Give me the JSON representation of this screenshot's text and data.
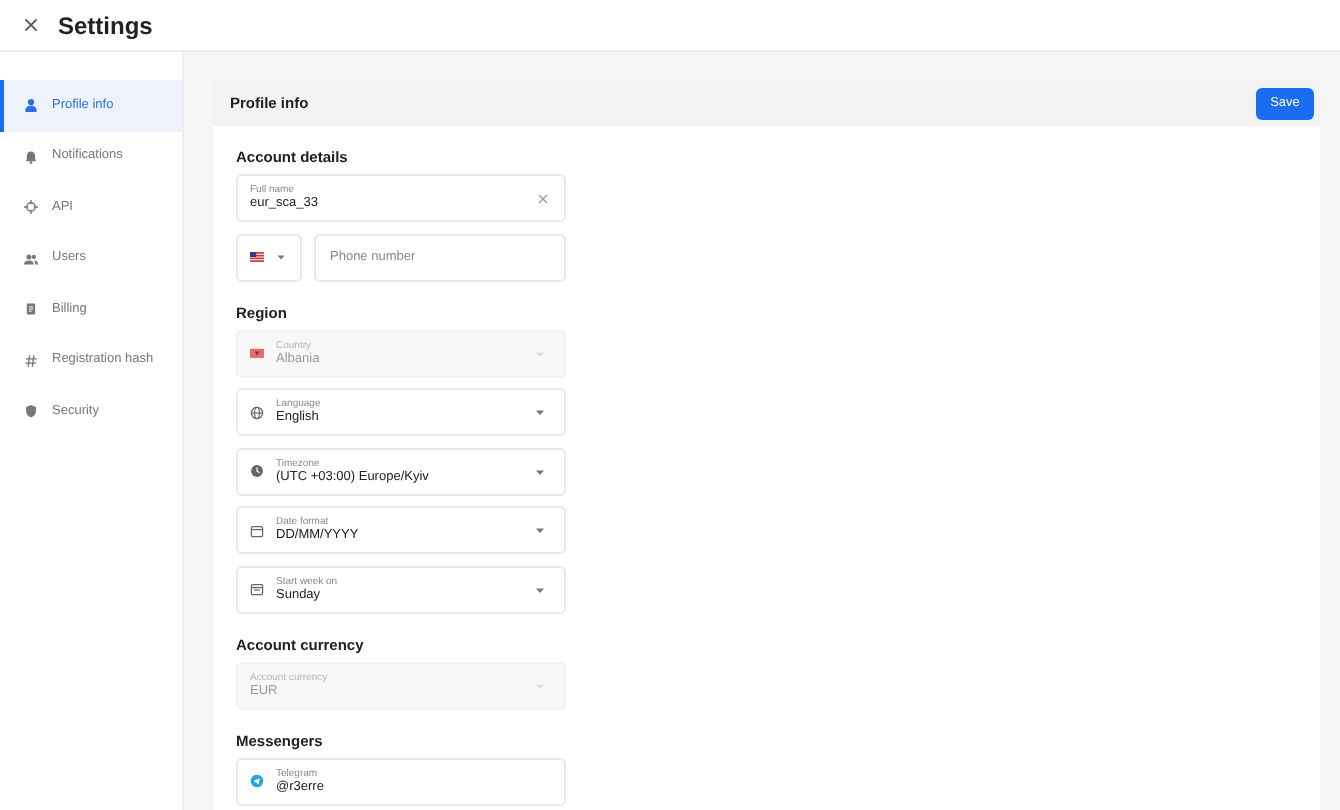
{
  "window": {
    "title": "Settings"
  },
  "sidebar": {
    "items": [
      {
        "label": "Profile info",
        "selected": true
      },
      {
        "label": "Notifications",
        "selected": false
      },
      {
        "label": "API",
        "selected": false
      },
      {
        "label": "Users",
        "selected": false
      },
      {
        "label": "Billing",
        "selected": false
      },
      {
        "label": "Registration hash",
        "selected": false
      },
      {
        "label": "Security",
        "selected": false
      }
    ]
  },
  "panel": {
    "title": "Profile info",
    "save_button": "Save",
    "sections": [
      {
        "title": "Account details",
        "fields": [
          {
            "kind": "text",
            "label": "Full name",
            "value": "eur_sca_33",
            "clearable": true
          },
          {
            "kind": "phone",
            "placeholder": "Phone number"
          }
        ]
      },
      {
        "title": "Region",
        "fields": [
          {
            "kind": "select",
            "label": "Country",
            "value": "Albania",
            "disabled": true
          },
          {
            "kind": "select",
            "label": "Language",
            "value": "English",
            "disabled": false
          },
          {
            "kind": "select",
            "label": "Timezone",
            "value": "(UTC +03:00) Europe/Kyiv",
            "disabled": false
          },
          {
            "kind": "select",
            "label": "Date format",
            "value": "DD/MM/YYYY",
            "disabled": false
          },
          {
            "kind": "select",
            "label": "Start week on",
            "value": "Sunday",
            "disabled": false
          }
        ]
      },
      {
        "title": "Account currency",
        "fields": [
          {
            "kind": "select",
            "label": "Account currency",
            "value": "EUR",
            "disabled": true
          }
        ]
      },
      {
        "title": "Messengers",
        "fields": [
          {
            "kind": "text",
            "label": "Telegram",
            "value": "@r3erre",
            "clearable": false
          }
        ]
      }
    ]
  }
}
